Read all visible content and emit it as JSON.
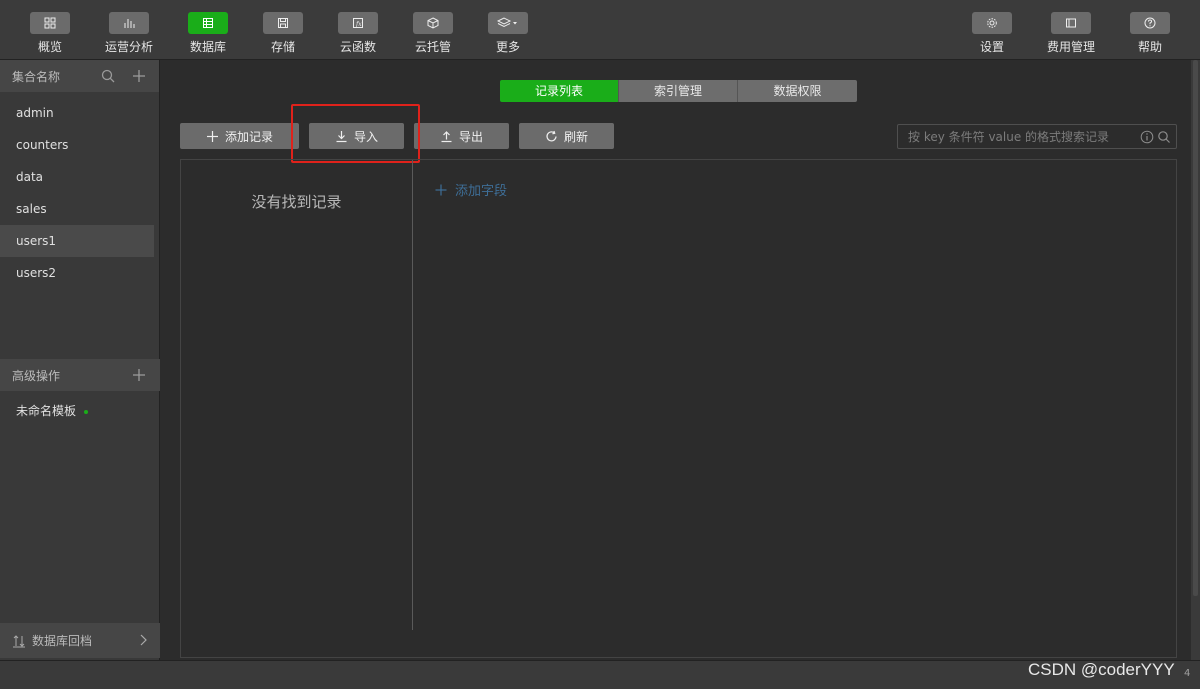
{
  "toolbar": {
    "left_items": [
      {
        "label": "概览",
        "icon": "grid-icon",
        "active": false
      },
      {
        "label": "运营分析",
        "icon": "bar-chart-icon",
        "active": false
      },
      {
        "label": "数据库",
        "icon": "database-icon",
        "active": true
      },
      {
        "label": "存储",
        "icon": "storage-icon",
        "active": false
      },
      {
        "label": "云函数",
        "icon": "function-icon",
        "active": false
      },
      {
        "label": "云托管",
        "icon": "cube-icon",
        "active": false
      },
      {
        "label": "更多",
        "icon": "layers-dropdown-icon",
        "active": false
      }
    ],
    "right_items": [
      {
        "label": "设置",
        "icon": "gear-icon"
      },
      {
        "label": "费用管理",
        "icon": "billing-icon"
      },
      {
        "label": "帮助",
        "icon": "help-icon"
      }
    ]
  },
  "sidebar": {
    "collections_title": "集合名称",
    "collections": [
      "admin",
      "counters",
      "data",
      "sales",
      "users1",
      "users2"
    ],
    "selected_collection": "users1",
    "advanced_title": "高级操作",
    "templates": [
      "未命名模板"
    ],
    "footer_label": "数据库回档"
  },
  "tabs": [
    "记录列表",
    "索引管理",
    "数据权限"
  ],
  "active_tab": "记录列表",
  "actions": {
    "add_record": "添加记录",
    "import": "导入",
    "export": "导出",
    "refresh": "刷新"
  },
  "search": {
    "placeholder": "按 key 条件符 value 的格式搜索记录"
  },
  "records_panel": {
    "empty_message": "没有找到记录",
    "add_field_label": "添加字段"
  },
  "watermark": "CSDN @coderYYY",
  "status_count": "4",
  "colors": {
    "accent_green": "#1aad19",
    "highlight_red": "#e0221b",
    "link_blue": "#3e6e97"
  }
}
